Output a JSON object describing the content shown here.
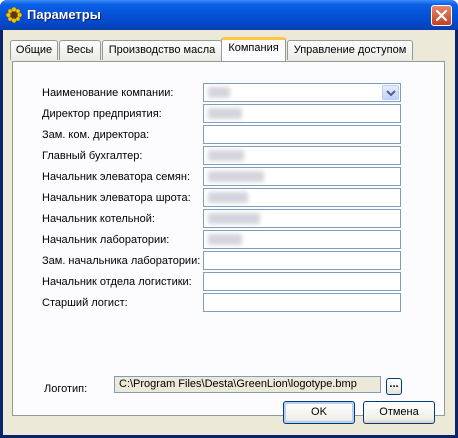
{
  "window": {
    "title": "Параметры",
    "title_icon": "sunflower-icon",
    "close_icon": "close-icon"
  },
  "tabs": [
    {
      "label": "Общие"
    },
    {
      "label": "Весы"
    },
    {
      "label": "Производство масла"
    },
    {
      "label": "Компания",
      "active": true
    },
    {
      "label": "Управление доступом"
    }
  ],
  "company": {
    "rows": [
      {
        "label": "Наименование компании:",
        "value": "",
        "type": "select",
        "redacted": true
      },
      {
        "label": "Директор предприятия:",
        "value": "",
        "redacted": true
      },
      {
        "label": "Зам. ком. директора:",
        "value": "",
        "redacted": false
      },
      {
        "label": "Главный бухгалтер:",
        "value": "",
        "redacted": true
      },
      {
        "label": "Начальник элеватора семян:",
        "value": "",
        "redacted": true
      },
      {
        "label": "Начальник элеватора шрота:",
        "value": "",
        "redacted": true
      },
      {
        "label": "Начальник котельной:",
        "value": "",
        "redacted": true
      },
      {
        "label": "Начальник лаборатории:",
        "value": "",
        "redacted": true
      },
      {
        "label": "Зам. начальника лаборатории:",
        "value": "",
        "redacted": false
      },
      {
        "label": "Начальник отдела логистики:",
        "value": "",
        "redacted": false
      },
      {
        "label": "Старший логист:",
        "value": "",
        "redacted": false
      }
    ],
    "logo_label": "Логотип:",
    "logo_path": "C:\\Program Files\\Desta\\GreenLion\\logotype.bmp",
    "browse_label": "..."
  },
  "buttons": {
    "ok": "OK",
    "cancel": "Отмена"
  }
}
